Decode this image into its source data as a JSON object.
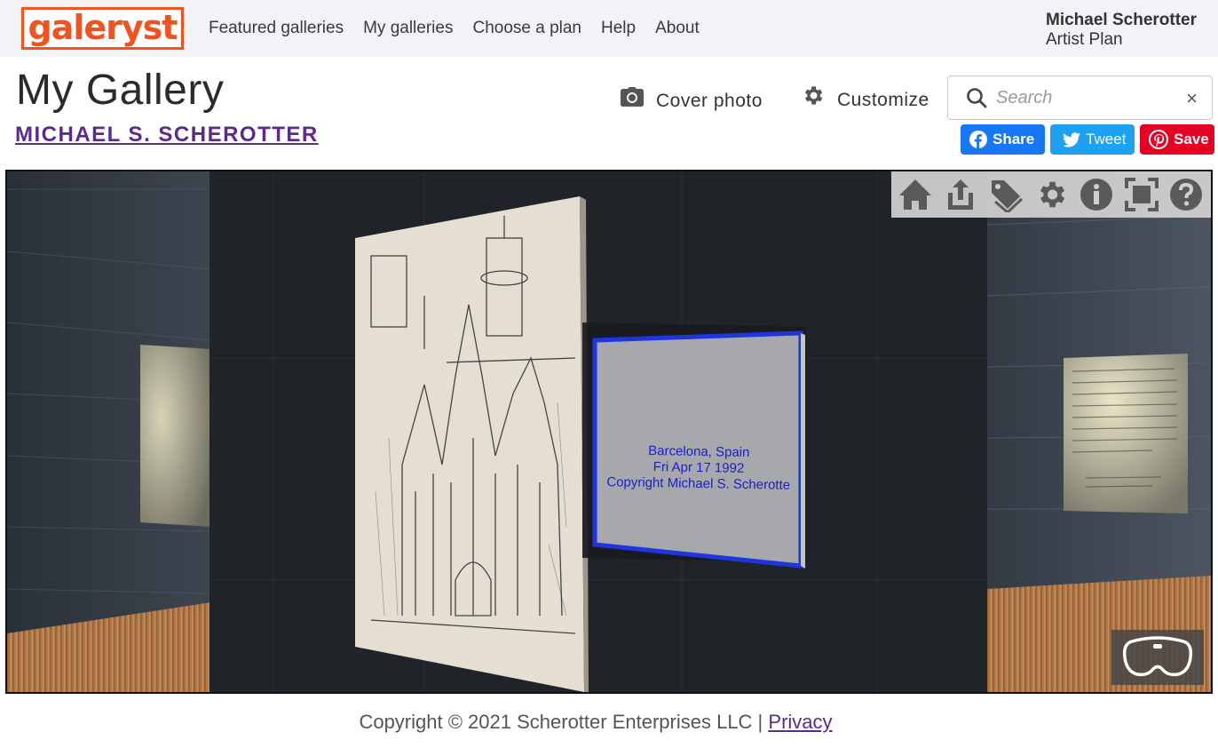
{
  "brand": {
    "logo_text": "galeryst",
    "accent": "#f0531f"
  },
  "nav": {
    "items": [
      "Featured galleries",
      "My galleries",
      "Choose a plan",
      "Help",
      "About"
    ]
  },
  "user": {
    "name": "Michael Scherotter",
    "plan": "Artist Plan"
  },
  "page": {
    "title": "My Gallery",
    "artist_link": "MICHAEL S. SCHEROTTER",
    "cover_photo_label": "Cover photo",
    "customize_label": "Customize"
  },
  "search": {
    "placeholder": "Search",
    "clear_icon": "×"
  },
  "share": {
    "facebook_label": "Share",
    "twitter_label": "Tweet",
    "pinterest_label": "Save"
  },
  "viewer": {
    "toolbar_icons": [
      "home-icon",
      "share-icon",
      "tag-icon",
      "gear-icon",
      "info-icon",
      "fullscreen-icon",
      "help-icon"
    ],
    "artwork_info": {
      "line1": "Barcelona, Spain",
      "line2": "Fri Apr 17 1992",
      "line3": "Copyright Michael S. Scherotte"
    },
    "vr_icon": "vr-headset-icon"
  },
  "footer": {
    "copyright": "Copyright © 2021 Scherotter Enterprises LLC |",
    "privacy": "Privacy"
  }
}
